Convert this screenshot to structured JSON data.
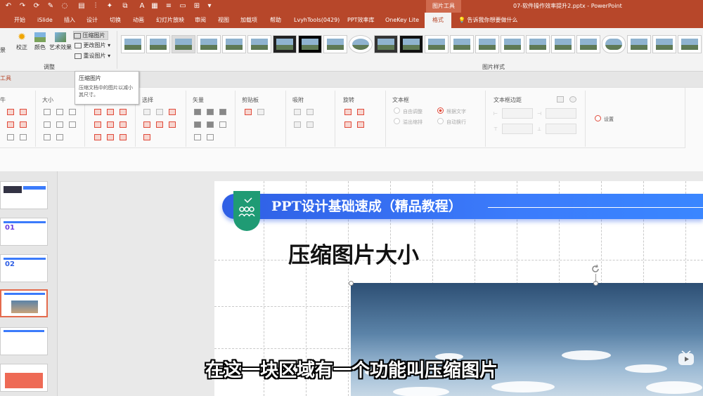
{
  "titlebar": {
    "context_tab": "图片工具",
    "document_title": "07-软件操作效率提升2.pptx - PowerPoint"
  },
  "tabs": [
    "开始",
    "iSlide",
    "插入",
    "设计",
    "切换",
    "动画",
    "幻灯片放映",
    "审阅",
    "视图",
    "加载项",
    "帮助",
    "LvyhTools(0429)",
    "PPT效率库",
    "OneKey Lite"
  ],
  "active_tab": "格式",
  "tell_me": "告诉我你想要做什么",
  "ribbon": {
    "partial_label": "景",
    "correct": "校正",
    "color": "颜色",
    "artistic": "艺术效果",
    "compress": "压缩图片",
    "change": "更改图片",
    "reset": "重设图片",
    "adjust_group": "调整",
    "styles_group": "图片样式"
  },
  "tooltip": {
    "title": "压缩图片",
    "desc": "压缩文档中的图片以减小其尺寸。"
  },
  "plugin": {
    "tools_label": "工具",
    "groups": [
      "牛",
      "大小",
      "选择",
      "矢量",
      "剪贴板",
      "吸附",
      "旋转",
      "文本框",
      "文本框边距"
    ],
    "autofit": "自由调整",
    "shrink": "溢出缩排",
    "fit_text": "根据文字",
    "wrap": "自动换行",
    "settings": "设置"
  },
  "thumbnails": [
    "",
    "01",
    "02",
    "",
    "",
    ""
  ],
  "slide": {
    "banner_title": "PPT设计基础速成（精品教程）",
    "heading": "压缩图片大小"
  },
  "subtitle": "在这一块区域有一个功能叫压缩图片",
  "colors": {
    "accent": "#b7472a",
    "banner_blue": "#3b7bfb",
    "badge_green": "#1f9b74"
  }
}
